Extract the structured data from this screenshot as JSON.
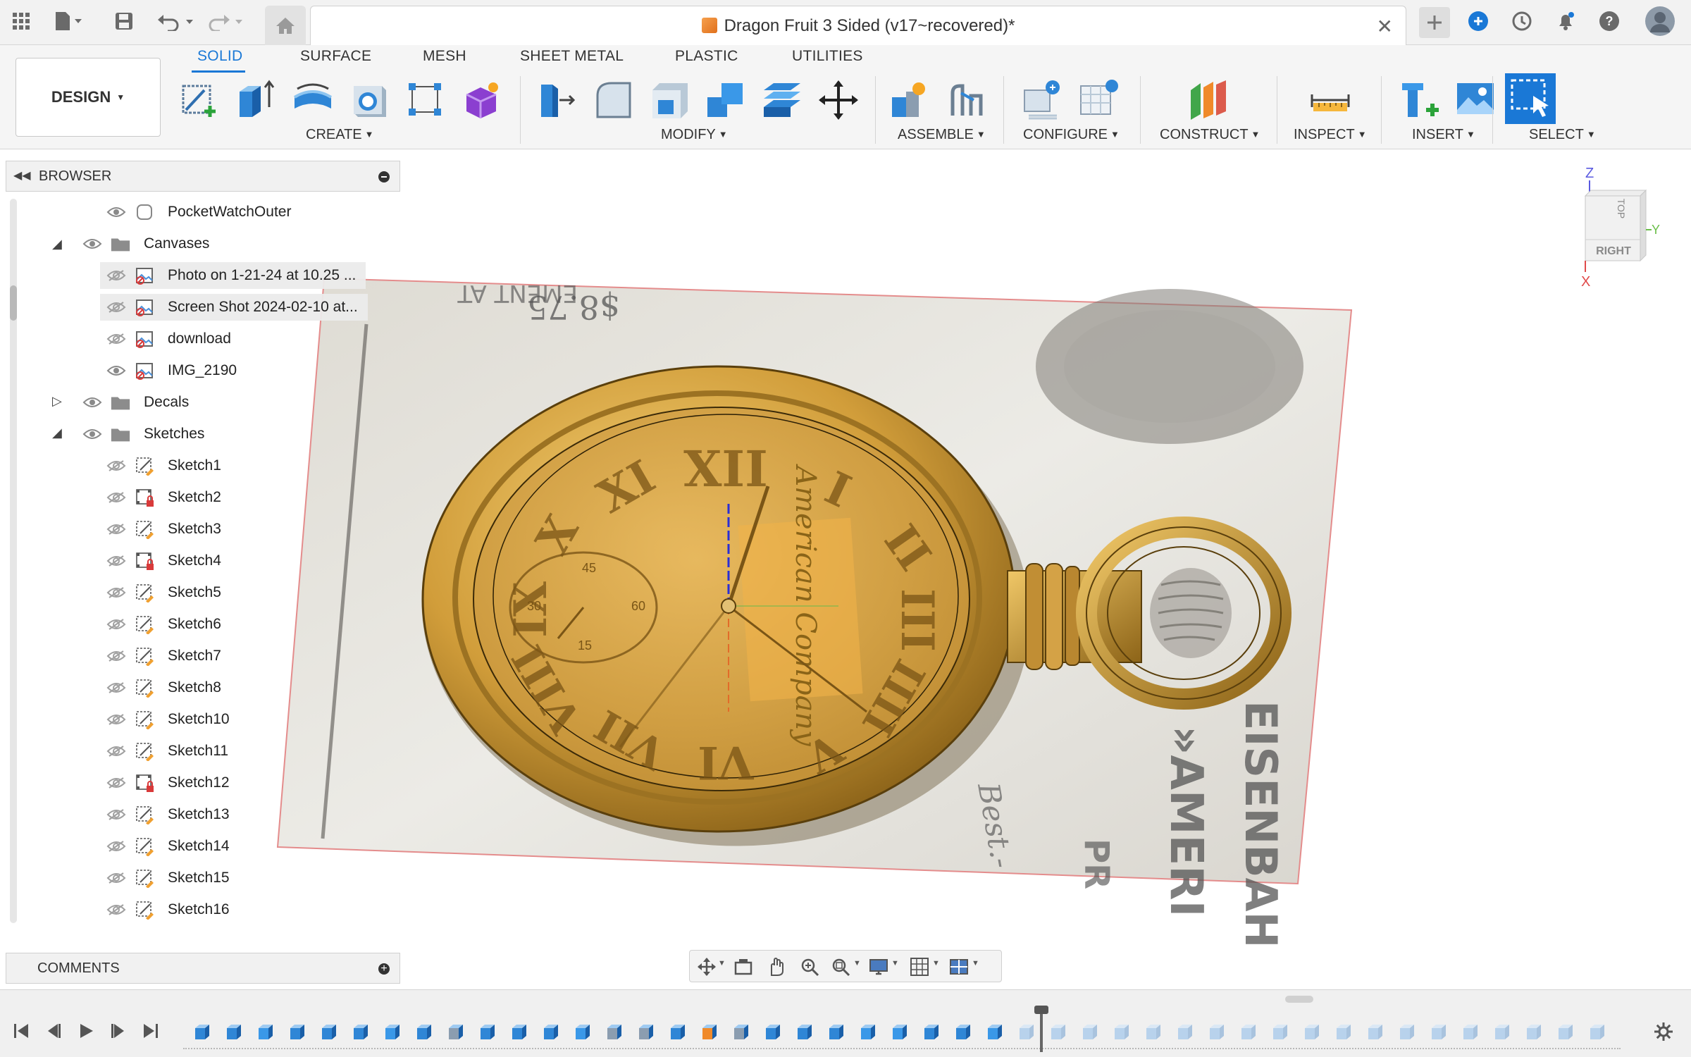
{
  "app": {
    "document_title": "Dragon Fruit 3 Sided (v17~recovered)*"
  },
  "ribbon": {
    "tabs": [
      "SOLID",
      "SURFACE",
      "MESH",
      "SHEET METAL",
      "PLASTIC",
      "UTILITIES"
    ],
    "active_tab": "SOLID",
    "workspace_label": "DESIGN",
    "groups": {
      "create": "CREATE",
      "modify": "MODIFY",
      "assemble": "ASSEMBLE",
      "configure": "CONFIGURE",
      "construct": "CONSTRUCT",
      "inspect": "INSPECT",
      "insert": "INSERT",
      "select": "SELECT"
    }
  },
  "browser": {
    "title": "BROWSER",
    "items": [
      {
        "label": "PocketWatchOuter",
        "type": "body",
        "visible": true
      },
      {
        "label": "Canvases",
        "type": "folder",
        "visible": true,
        "expanded": true
      },
      {
        "label": "Photo on 1-21-24 at 10.25 ...",
        "type": "canvas",
        "visible": false
      },
      {
        "label": "Screen Shot 2024-02-10 at...",
        "type": "canvas",
        "visible": false
      },
      {
        "label": "download",
        "type": "canvas",
        "visible": false
      },
      {
        "label": "IMG_2190",
        "type": "canvas",
        "visible": true
      },
      {
        "label": "Decals",
        "type": "folder",
        "visible": true,
        "expanded": false
      },
      {
        "label": "Sketches",
        "type": "folder",
        "visible": true,
        "expanded": true
      },
      {
        "label": "Sketch1",
        "type": "sketch",
        "visible": false
      },
      {
        "label": "Sketch2",
        "type": "sketch-locked",
        "visible": false
      },
      {
        "label": "Sketch3",
        "type": "sketch",
        "visible": false
      },
      {
        "label": "Sketch4",
        "type": "sketch-locked",
        "visible": false
      },
      {
        "label": "Sketch5",
        "type": "sketch",
        "visible": false
      },
      {
        "label": "Sketch6",
        "type": "sketch",
        "visible": false
      },
      {
        "label": "Sketch7",
        "type": "sketch",
        "visible": false
      },
      {
        "label": "Sketch8",
        "type": "sketch",
        "visible": false
      },
      {
        "label": "Sketch10",
        "type": "sketch",
        "visible": false
      },
      {
        "label": "Sketch11",
        "type": "sketch",
        "visible": false
      },
      {
        "label": "Sketch12",
        "type": "sketch-locked",
        "visible": false
      },
      {
        "label": "Sketch13",
        "type": "sketch",
        "visible": false
      },
      {
        "label": "Sketch14",
        "type": "sketch",
        "visible": false
      },
      {
        "label": "Sketch15",
        "type": "sketch",
        "visible": false
      },
      {
        "label": "Sketch16",
        "type": "sketch",
        "visible": false
      }
    ]
  },
  "comments": {
    "title": "COMMENTS"
  },
  "viewcube": {
    "top_label": "TOP",
    "face_label": "RIGHT",
    "axis_z": "Z",
    "axis_y": "Y",
    "axis_x": "X"
  },
  "canvas_image": {
    "dial_numerals": [
      "XII",
      "I",
      "II",
      "III",
      "IIII",
      "V",
      "VI",
      "VII",
      "VIII",
      "IX",
      "X",
      "XI"
    ],
    "subdial_numbers": [
      "45",
      "30",
      "60",
      "15"
    ],
    "dial_brand": "American Company",
    "background_text": [
      "$8.75",
      "EMENT AT",
      "EISENBAH",
      "»AMERI",
      "Best.-",
      "PR"
    ]
  },
  "colors": {
    "accent": "#1a78d6",
    "gold": "#c9962e",
    "gold_light": "#e8bb5a",
    "gold_dark": "#8a6418",
    "paper": "#e9e6df"
  }
}
